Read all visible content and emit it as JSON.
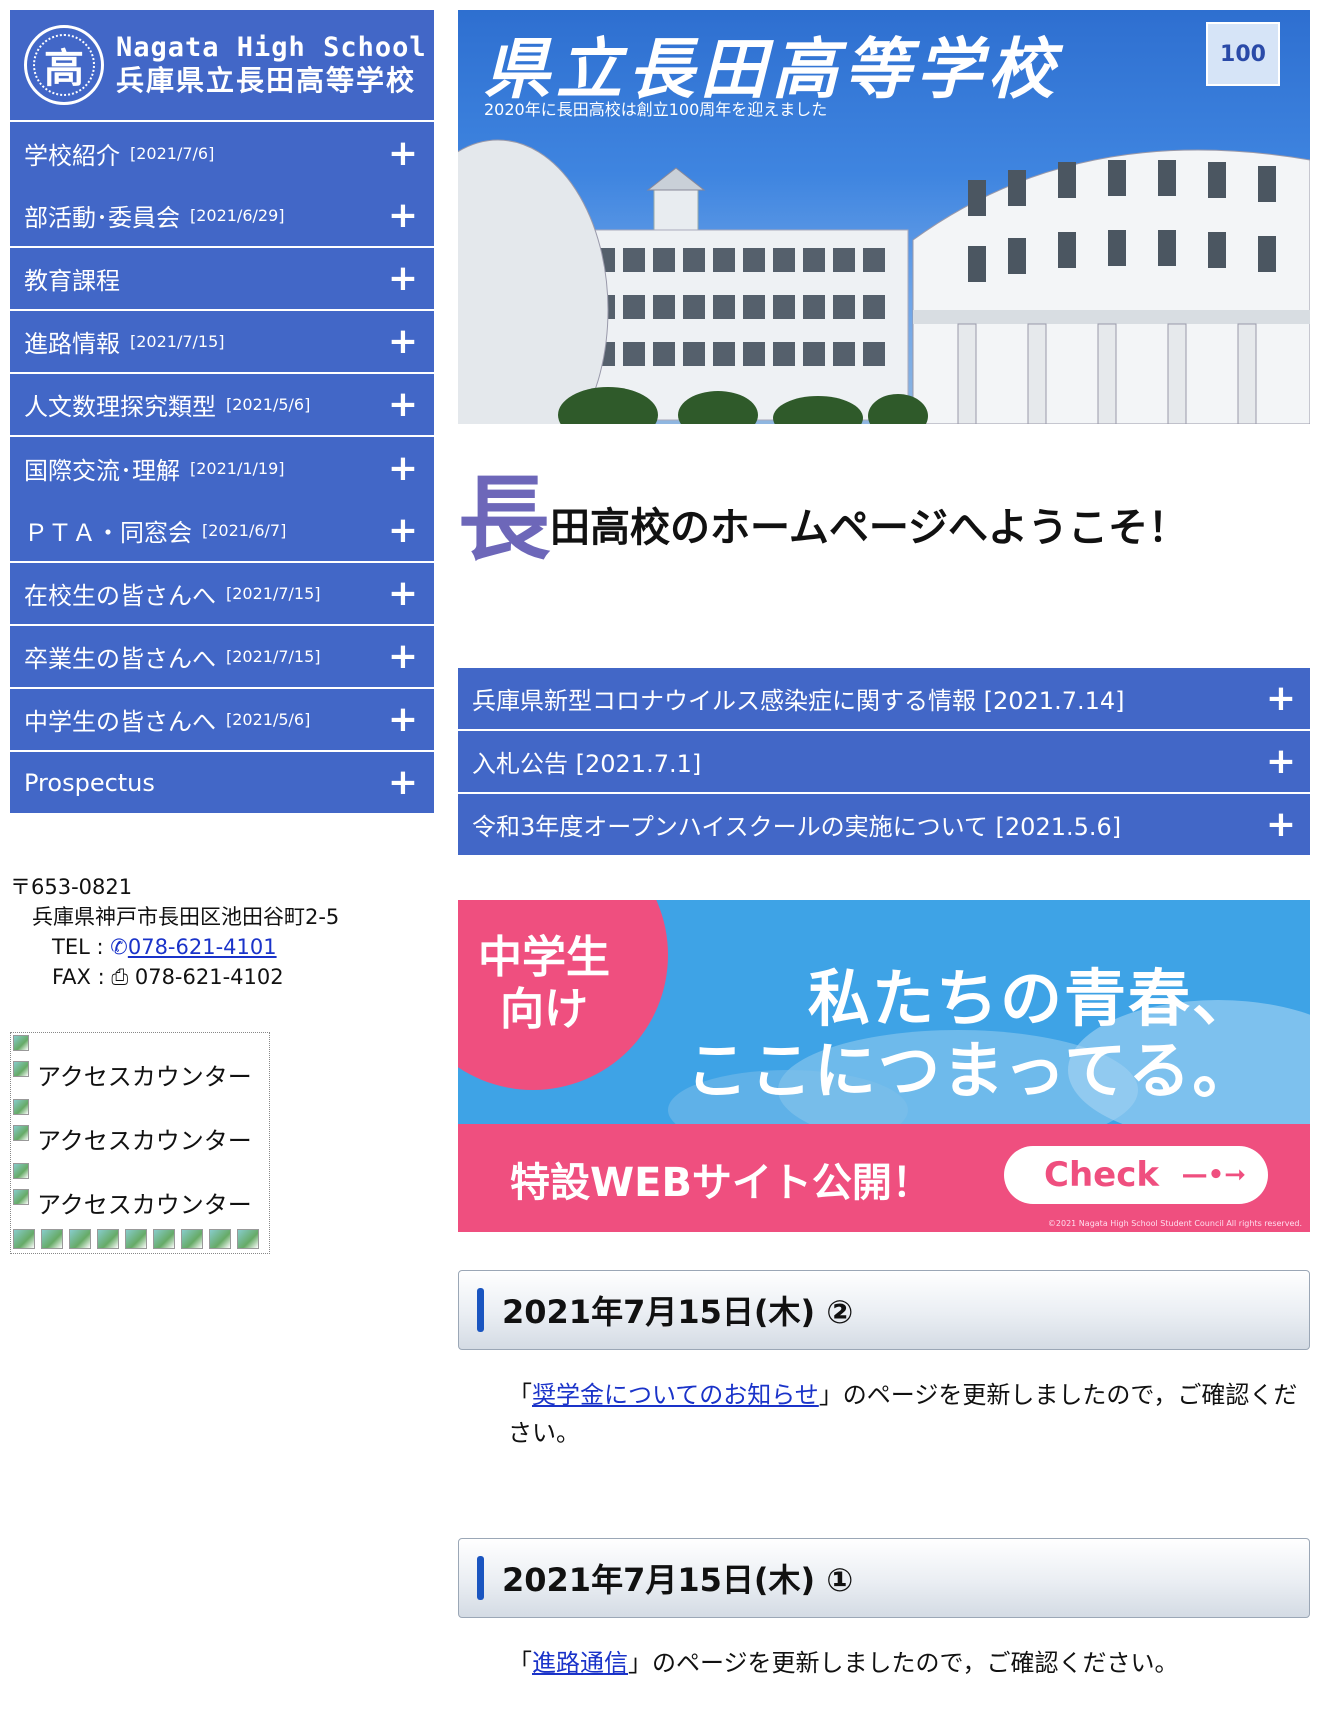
{
  "logo": {
    "crest_char": "高",
    "name_en": "Nagata High School",
    "name_ja": "兵庫県立長田高等学校"
  },
  "menu": [
    {
      "label": "学校紹介",
      "date": "[2021/7/6]"
    },
    {
      "label": "部活動･委員会",
      "date": "[2021/6/29]"
    },
    {
      "label": "教育課程",
      "date": ""
    },
    {
      "label": "進路情報",
      "date": "[2021/7/15]"
    },
    {
      "label": "人文数理探究類型",
      "date": "[2021/5/6]"
    },
    {
      "label": "国際交流･理解",
      "date": "[2021/1/19]"
    },
    {
      "label": "ＰＴＡ・同窓会",
      "date": "[2021/6/7]"
    },
    {
      "label": "在校生の皆さんへ",
      "date": "[2021/7/15]"
    },
    {
      "label": "卒業生の皆さんへ",
      "date": "[2021/7/15]"
    },
    {
      "label": "中学生の皆さんへ",
      "date": "[2021/5/6]"
    },
    {
      "label": "Prospectus",
      "date": ""
    }
  ],
  "plus_glyph": "+",
  "address": {
    "postal_mark": "〒",
    "postal_code": "653-0821",
    "street": "兵庫県神戸市長田区池田谷町2-5",
    "tel_label": "TEL :",
    "tel_icon": "phone-icon",
    "tel": "078-621-4101",
    "fax_label": "FAX :",
    "fax_icon": "fax-icon",
    "fax": "078-621-4102"
  },
  "counter": {
    "alt_text": "アクセスカウンター"
  },
  "hero": {
    "title": "県立長田高等学校",
    "subtitle": "2020年に長田高校は創立100周年を迎えました",
    "badge_text": "100"
  },
  "welcome": {
    "first_char": "長",
    "rest": "田高校のホームページへようこそ！"
  },
  "notices": [
    {
      "label": "兵庫県新型コロナウイルス感染症に関する情報 [2021.7.14]"
    },
    {
      "label": "入札公告 [2021.7.1]"
    },
    {
      "label": "令和3年度オープンハイスクールの実施について [2021.5.6]"
    }
  ],
  "banner": {
    "tag_line1": "中学生",
    "tag_line2": "向け",
    "slogan_line1": "私たちの青春、",
    "slogan_line2": "ここにつまってる。",
    "web_text": "特設WEBサイト公開！",
    "check_label": "Check",
    "copyright": "©2021 Nagata High School Student Council All rights reserved.",
    "colors": {
      "sky": "#3ea3e6",
      "pink": "#ef4f7f"
    }
  },
  "posts": [
    {
      "title": "2021年7月15日(木) ②",
      "prefix": "「",
      "link": "奨学金についてのお知らせ",
      "suffix": "」のページを更新しましたので，ご確認ください。"
    },
    {
      "title": "2021年7月15日(木) ①",
      "prefix": "「",
      "link": "進路通信",
      "suffix": "」のページを更新しましたので，ご確認ください。"
    }
  ],
  "colors": {
    "menu_blue": "#4267c7",
    "welcome_accent": "#6d67b9",
    "link": "#1a33c9"
  }
}
